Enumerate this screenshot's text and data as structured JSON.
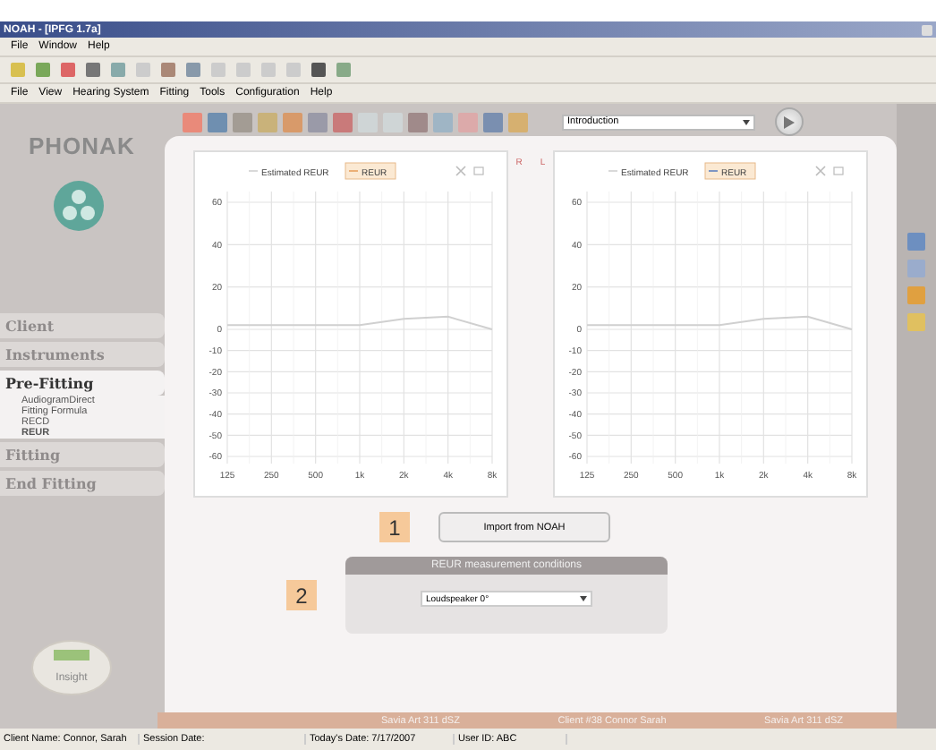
{
  "window": {
    "title": "NOAH - [IPFG 1.7a]"
  },
  "app_menu": [
    "File",
    "Window",
    "Help"
  ],
  "menu": [
    "File",
    "View",
    "Hearing System",
    "Fitting",
    "Tools",
    "Configuration",
    "Help"
  ],
  "session_dropdown": {
    "value": "Introduction"
  },
  "brand": "PHONAK",
  "nav": [
    {
      "label": "Client",
      "expanded": false
    },
    {
      "label": "Instruments",
      "expanded": false
    },
    {
      "label": "Pre-Fitting",
      "expanded": true,
      "children": [
        {
          "label": "AudiogramDirect",
          "selected": false
        },
        {
          "label": "Fitting Formula",
          "selected": false
        },
        {
          "label": "RECD",
          "selected": false
        },
        {
          "label": "REUR",
          "selected": true
        }
      ]
    },
    {
      "label": "Fitting",
      "expanded": false
    },
    {
      "label": "End Fitting",
      "expanded": false
    }
  ],
  "insight_label": "Insight",
  "charts": [
    {
      "side_mark": "R",
      "legend": [
        {
          "selected": false
        },
        {
          "selected": true
        }
      ],
      "chart_data": {
        "type": "line",
        "categories": [
          "125",
          "250",
          "500",
          "1k",
          "2k",
          "4k",
          "8k"
        ],
        "series": [
          {
            "name": "Estimated REUR",
            "color": "#d0d0d0",
            "values": [
              2,
              2,
              2,
              2,
              5,
              6,
              0
            ]
          },
          {
            "name": "REUR",
            "color": "#e8a060",
            "values": [
              null,
              null,
              null,
              null,
              null,
              null,
              null
            ]
          }
        ],
        "grid": true,
        "ylim": [
          -60,
          60
        ],
        "yticks": [
          60,
          40,
          20,
          0,
          -10,
          -20,
          -30,
          -40,
          -50,
          -60
        ]
      }
    },
    {
      "side_mark": "L",
      "legend": [
        {
          "selected": false
        },
        {
          "selected": true
        }
      ],
      "chart_data": {
        "type": "line",
        "categories": [
          "125",
          "250",
          "500",
          "1k",
          "2k",
          "4k",
          "8k"
        ],
        "series": [
          {
            "name": "Estimated REUR",
            "color": "#d0d0d0",
            "values": [
              2,
              2,
              2,
              2,
              5,
              6,
              0
            ]
          },
          {
            "name": "REUR",
            "color": "#6080c0",
            "values": [
              null,
              null,
              null,
              null,
              null,
              null,
              null
            ]
          }
        ],
        "grid": true,
        "ylim": [
          -60,
          60
        ],
        "yticks": [
          60,
          40,
          20,
          0,
          -10,
          -20,
          -30,
          -40,
          -50,
          -60
        ]
      }
    }
  ],
  "callouts": [
    "1",
    "2"
  ],
  "import_button": "Import from NOAH",
  "conditions": {
    "title": "REUR measurement conditions",
    "value": "Loudspeaker 0°"
  },
  "device_bar": [
    "Savia Art 311 dSZ",
    "Client #38 Connor Sarah",
    "Savia Art 311 dSZ"
  ],
  "status_bar": [
    "Client Name:  Connor, Sarah",
    "Session Date:",
    "Today's Date:  7/17/2007",
    "User ID:  ABC"
  ]
}
